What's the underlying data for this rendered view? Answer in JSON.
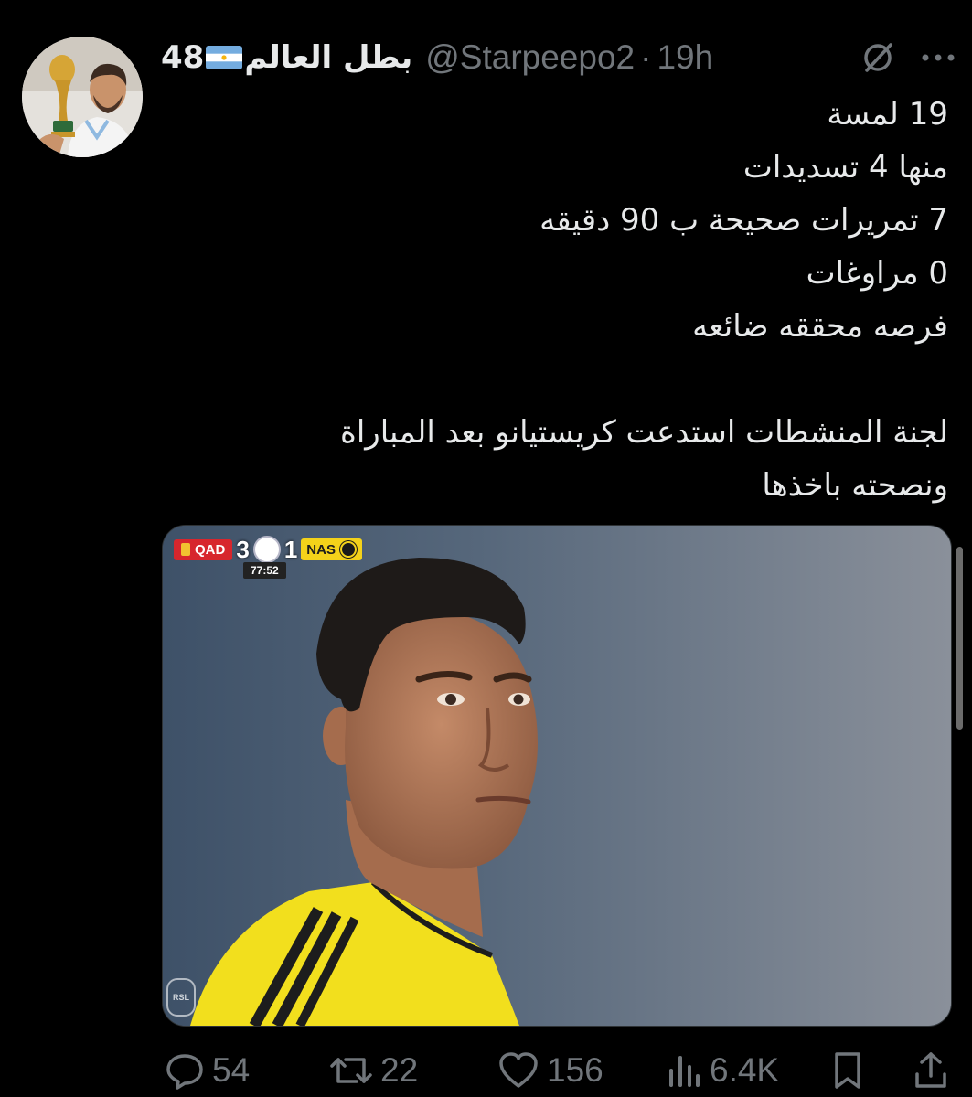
{
  "tweet": {
    "author": {
      "display_name": "بطل العالم",
      "display_name_suffix": "48",
      "flag_icon": "argentina-flag-icon",
      "handle": "@Starpeepo2",
      "separator": "·",
      "time": "19h"
    },
    "lines": [
      "19 لمسة",
      "منها 4 تسديدات",
      "7 تمريرات صحيحة ب 90 دقيقه",
      "0 مراوغات",
      "فرصه محققه ضائعه",
      "",
      "لجنة المنشطات استدعت كريستيانو بعد المباراة",
      "ونصحته باخذها"
    ],
    "media": {
      "scorebug": {
        "home_team": "QAD",
        "home_score": "3",
        "away_score": "1",
        "away_team": "NAS",
        "clock": "77:52"
      },
      "watermark": "RSL"
    },
    "actions": {
      "replies": "54",
      "retweets": "22",
      "likes": "156",
      "views": "6.4K"
    }
  },
  "colors": {
    "background": "#000000",
    "text_primary": "#e7e9ea",
    "text_secondary": "#71767b",
    "home_team": "#d7262d",
    "away_team": "#f4d21a"
  },
  "icons": {
    "grok": "grok-icon",
    "more": "more-icon",
    "reply": "reply-icon",
    "retweet": "retweet-icon",
    "like": "heart-icon",
    "views": "views-icon",
    "bookmark": "bookmark-icon",
    "share": "share-icon"
  }
}
